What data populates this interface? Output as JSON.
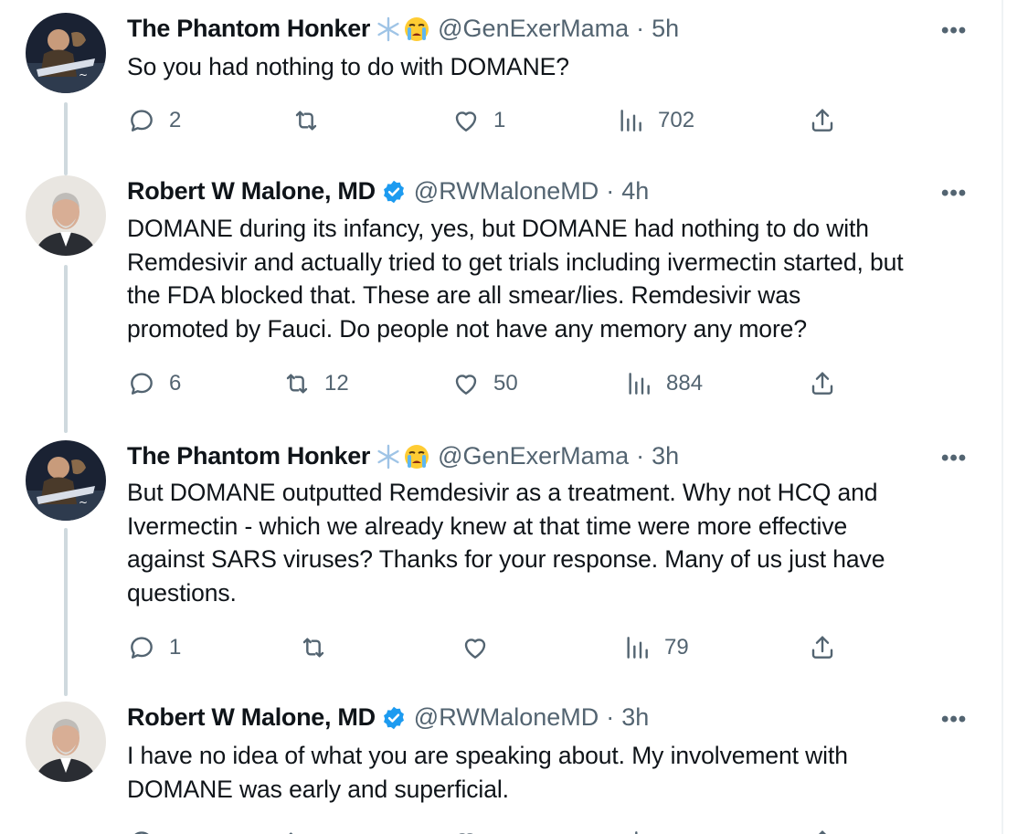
{
  "tweets": [
    {
      "name": "The Phantom Honker",
      "handle": "@GenExerMama",
      "time": "5h",
      "text": "So you had nothing to do with DOMANE?",
      "replies": "2",
      "retweets": "",
      "likes": "1",
      "views": "702",
      "emojis": [
        "snowflake-emoji",
        "crying-face-emoji"
      ]
    },
    {
      "name": "Robert W Malone, MD",
      "handle": "@RWMaloneMD",
      "time": "4h",
      "text": [
        "DOMANE during its infancy, yes, but DOMANE had nothing to do with",
        "Remdesivir and actually tried to get trials including ivermectin started, but",
        "the FDA blocked that.  These are all smear/lies.  Remdesivir was",
        "promoted by Fauci.  Do people not have any memory any more?"
      ],
      "replies": "6",
      "retweets": "12",
      "likes": "50",
      "views": "884",
      "verified": true
    },
    {
      "name": "The Phantom Honker",
      "handle": "@GenExerMama",
      "time": "3h",
      "text": [
        "But DOMANE outputted Remdesivir as a treatment. Why not HCQ and",
        "Ivermectin - which we already knew at that time were more effective",
        "against SARS viruses? Thanks for your response. Many of us just have",
        "questions."
      ],
      "replies": "1",
      "retweets": "",
      "likes": "",
      "views": "79",
      "emojis": [
        "snowflake-emoji",
        "crying-face-emoji"
      ]
    },
    {
      "name": "Robert W Malone, MD",
      "handle": "@RWMaloneMD",
      "time": "3h",
      "text": [
        "I have no idea of what you are speaking about.  My involvement with",
        "DOMANE was early and superficial."
      ],
      "verified": true
    }
  ],
  "colors": {
    "text": "#0f1419",
    "secondary": "#536471",
    "verified": "#1d9bf0",
    "thread_line": "#cfd9de"
  }
}
